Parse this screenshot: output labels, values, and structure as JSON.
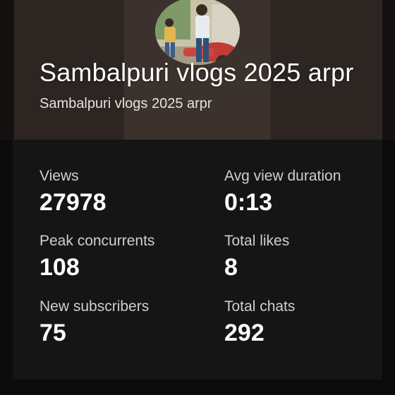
{
  "header": {
    "title": "Sambalpuri vlogs 2025 arpr",
    "subtitle": "Sambalpuri vlogs 2025 arpr",
    "avatar_icon": "channel-avatar-photo"
  },
  "stats": [
    {
      "label": "Views",
      "value": "27978"
    },
    {
      "label": "Avg view duration",
      "value": "0:13"
    },
    {
      "label": "Peak concurrents",
      "value": "108"
    },
    {
      "label": "Total likes",
      "value": "8"
    },
    {
      "label": "New subscribers",
      "value": "75"
    },
    {
      "label": "Total chats",
      "value": "292"
    }
  ],
  "colors": {
    "background": "#0b0b0b",
    "card": "#151515",
    "text_primary": "#ffffff",
    "text_secondary": "#cfcfcf"
  }
}
